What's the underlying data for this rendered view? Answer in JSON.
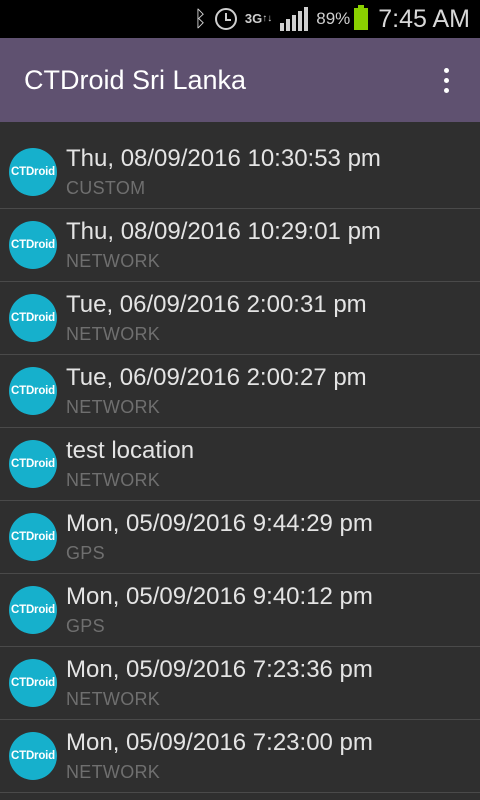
{
  "status_bar": {
    "battery_percent": "89%",
    "time": "7:45 AM",
    "network": "3G",
    "icons": [
      "bluetooth-icon",
      "alarm-icon",
      "signal-icon",
      "battery-icon"
    ]
  },
  "app_bar": {
    "title": "CTDroid Sri Lanka",
    "background_color": "#5f5170"
  },
  "list": {
    "avatar_text": "CTDroid",
    "avatar_color": "#16b0cc",
    "items": [
      {
        "title": "Thu, 08/09/2016 10:30:53 pm",
        "subtitle": "CUSTOM"
      },
      {
        "title": "Thu, 08/09/2016 10:29:01 pm",
        "subtitle": "NETWORK"
      },
      {
        "title": "Tue, 06/09/2016 2:00:31 pm",
        "subtitle": "NETWORK"
      },
      {
        "title": "Tue, 06/09/2016 2:00:27 pm",
        "subtitle": "NETWORK"
      },
      {
        "title": "test location",
        "subtitle": "NETWORK"
      },
      {
        "title": "Mon, 05/09/2016 9:44:29 pm",
        "subtitle": "GPS"
      },
      {
        "title": "Mon, 05/09/2016 9:40:12 pm",
        "subtitle": "GPS"
      },
      {
        "title": "Mon, 05/09/2016 7:23:36 pm",
        "subtitle": "NETWORK"
      },
      {
        "title": "Mon, 05/09/2016 7:23:00 pm",
        "subtitle": "NETWORK"
      }
    ]
  }
}
